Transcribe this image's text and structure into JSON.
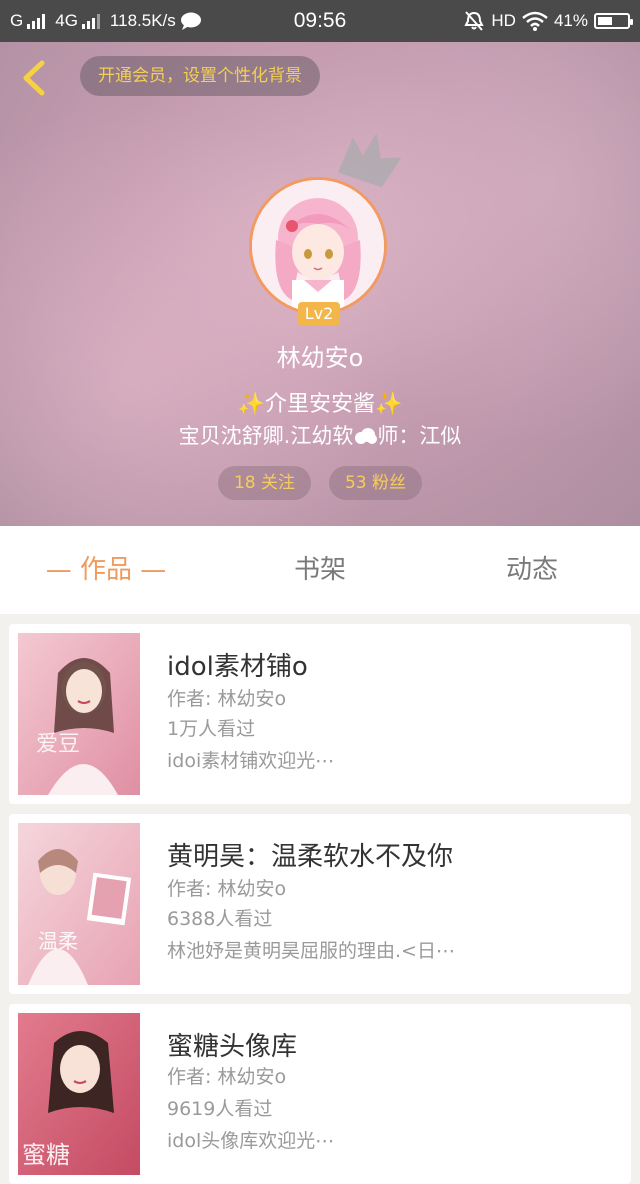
{
  "status_bar": {
    "carrier": "G",
    "network": "4G",
    "speed": "118.5K/s",
    "time": "09:56",
    "hd": "HD",
    "battery": "41%"
  },
  "header": {
    "vip_promo": "开通会员，设置个性化背景",
    "level": "Lv2",
    "username": "林幼安o",
    "signature_line1": "介里安安酱",
    "signature_line2_a": "宝贝沈舒卿.江幼软",
    "signature_line2_b": "师：江似",
    "following": "18 关注",
    "followers": "53 粉丝"
  },
  "tabs": [
    "作品",
    "书架",
    "动态"
  ],
  "active_tab_index": 0,
  "works": [
    {
      "title": "idol素材铺o",
      "author": "作者: 林幼安o",
      "views": "1万人看过",
      "intro": "idoi素材铺欢迎光⋯"
    },
    {
      "title": "黄明昊：温柔软水不及你",
      "author": "作者: 林幼安o",
      "views": "6388人看过",
      "intro": "林池妤是黄明昊屈服的理由.<日⋯"
    },
    {
      "title": "蜜糖头像库",
      "author": "作者: 林幼安o",
      "views": "9619人看过",
      "intro": "idol头像库欢迎光⋯"
    }
  ],
  "colors": {
    "accent": "#ef9b5e",
    "gold": "#f3cf55",
    "header_bg": "#c59cb0",
    "page_bg": "#f3f1ee"
  }
}
